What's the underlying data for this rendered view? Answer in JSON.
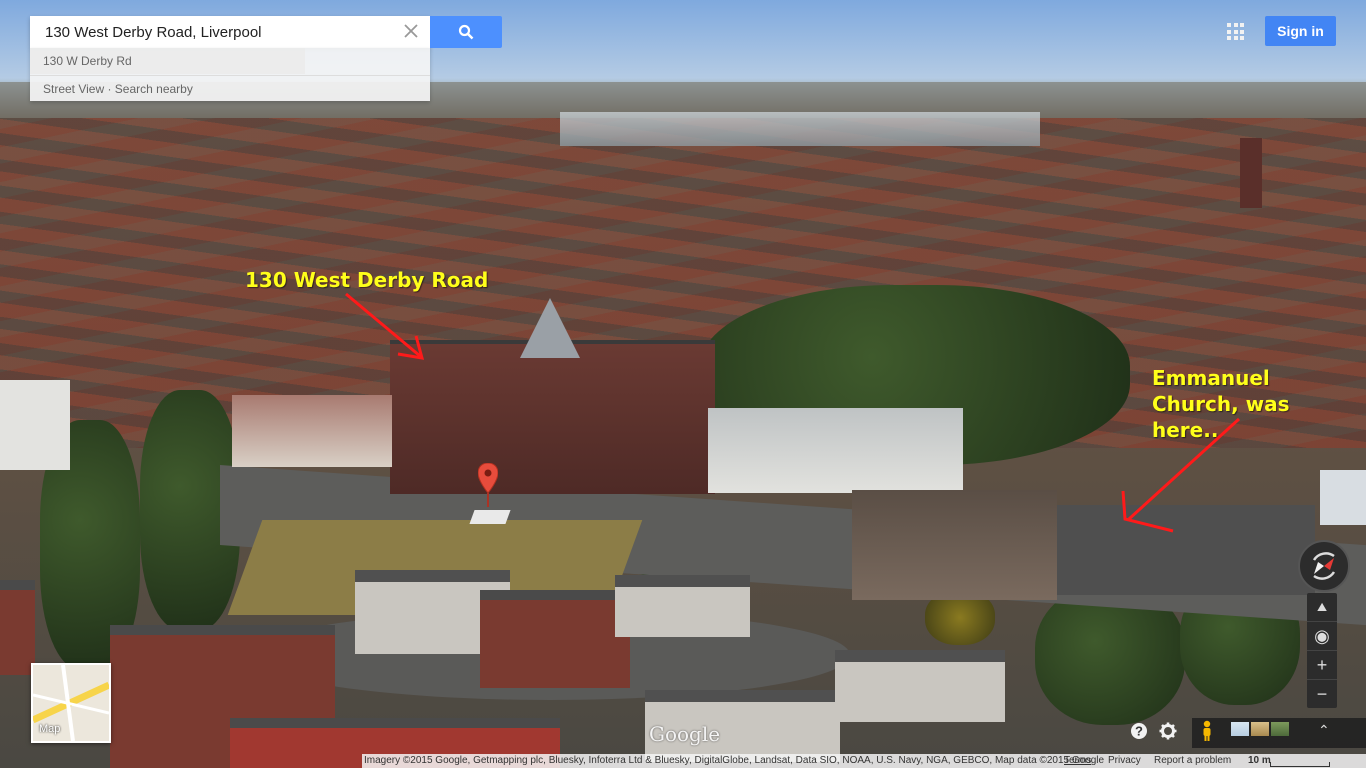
{
  "search": {
    "value": "130 West Derby Road, Liverpool",
    "suggestion_1": "130 W Derby Rd",
    "suggestion_2": "Street View · Search nearby"
  },
  "header": {
    "sign_in_label": "Sign in"
  },
  "annotations": {
    "address_label": "130 West Derby Road",
    "church_label_line1": "Emmanuel",
    "church_label_line2": "Church, was",
    "church_label_line3": "here..",
    "color": "#ffff1a",
    "arrow_color": "#ff1a1a"
  },
  "map": {
    "minimap_label": "Map",
    "logo": "Google"
  },
  "footer": {
    "imagery": "Imagery ©2015 Google, Getmapping plc, Bluesky, Infoterra Ltd & Bluesky, DigitalGlobe, Landsat, Data SIO, NOAA, U.S. Navy, NGA, GEBCO, Map data ©2015 Google",
    "terms": "Terms",
    "privacy": "Privacy",
    "report": "Report a problem",
    "scale": "10 m"
  },
  "icons": [
    "search-icon",
    "close-icon",
    "apps-grid-icon",
    "map-pin-icon",
    "compass-icon",
    "tilt-icon",
    "my-location-icon",
    "zoom-in-icon",
    "zoom-out-icon",
    "help-icon",
    "gear-icon",
    "pegman-icon",
    "chevron-up-icon"
  ]
}
